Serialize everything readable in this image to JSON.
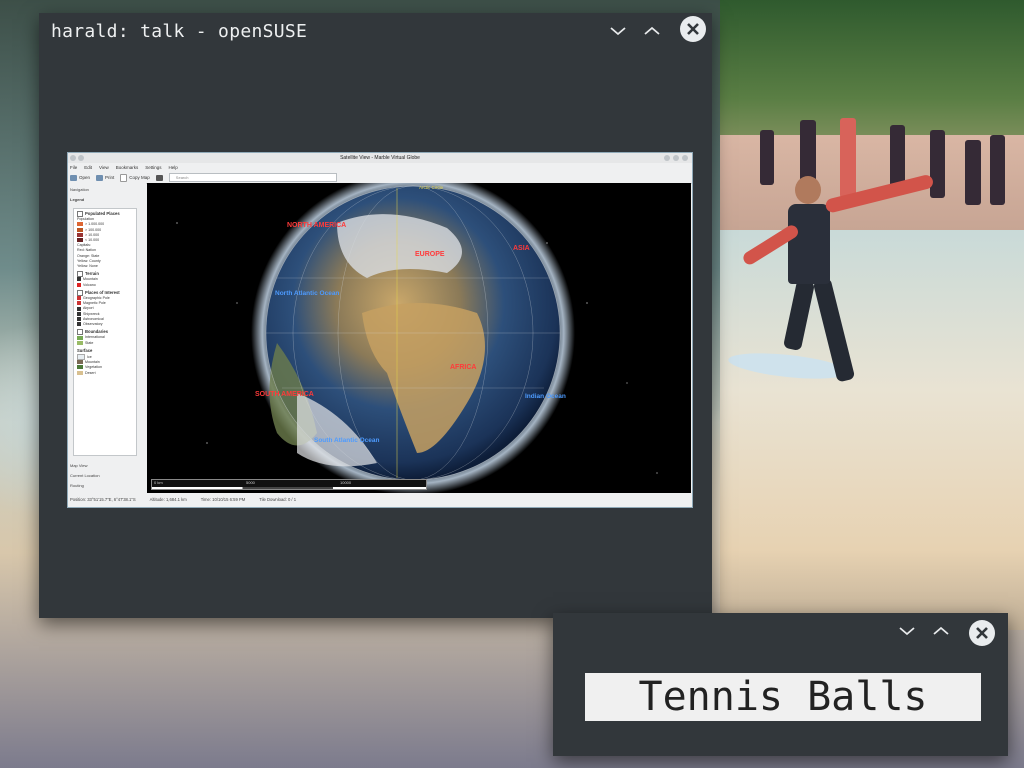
{
  "main_window": {
    "title": "harald: talk - openSUSE",
    "controls": [
      "minimize",
      "maximize",
      "close"
    ]
  },
  "marble": {
    "window_title": "Satellite View - Marble Virtual Globe",
    "menu": [
      "File",
      "Edit",
      "View",
      "Bookmarks",
      "Settings",
      "Help"
    ],
    "toolbar": {
      "open": "Open",
      "print": "Print",
      "copy_map": "Copy Map",
      "search_placeholder": "Search"
    },
    "side_tabs": {
      "navigation": "Navigation",
      "legend": "Legend",
      "map_view": "Map View",
      "current_location": "Current Location",
      "routing": "Routing"
    },
    "legend": {
      "populated_places": "Populated Places",
      "population": "Population",
      "pop_1": "> 1.000.000",
      "pop_2": "> 100.000",
      "pop_3": "> 10.000",
      "pop_4": "< 10.000",
      "capitals": "Capitals:",
      "capital_1": "Red: Nation",
      "capital_2": "Orange: State",
      "capital_3": "Yellow: County",
      "capital_4": "Yellow: None",
      "terrain": "Terrain",
      "mountain": "Mountain",
      "volcano": "Volcano",
      "places_of_interest": "Places of Interest",
      "poi_1": "Geographic Pole",
      "poi_2": "Magnetic Pole",
      "poi_3": "Airport",
      "poi_4": "Shipwreck",
      "poi_5": "Astronomical",
      "poi_6": "Observatory",
      "boundaries": "Boundaries",
      "international": "International",
      "state": "State",
      "surface": "Surface",
      "ice": "Ice",
      "mountain_surface": "Mountain",
      "vegetation": "Vegetation",
      "desert": "Desert"
    },
    "globe_labels": {
      "north_america": "NORTH AMERICA",
      "europe": "EUROPE",
      "asia": "ASIA",
      "africa": "AFRICA",
      "south_america": "SOUTH AMERICA",
      "north_atlantic": "North Atlantic Ocean",
      "south_atlantic": "South Atlantic Ocean",
      "indian_ocean": "Indian Ocean",
      "arctic_circle": "Arctic Circle",
      "antarctic": "Antarctica"
    },
    "scale": {
      "s0": "0 km",
      "s1": "5000",
      "s2": "10000"
    },
    "status": {
      "position": "Position: 33°51'15.7\"E, 6°47'38.1\"S",
      "altitude": "Altitude: 1,684.1 km",
      "time": "Time: 10/10/15 6:59 PM",
      "download": "Tile Download: 0 / 1"
    }
  },
  "small_window": {
    "text": "Tennis Balls",
    "controls": [
      "minimize",
      "maximize",
      "close"
    ]
  }
}
